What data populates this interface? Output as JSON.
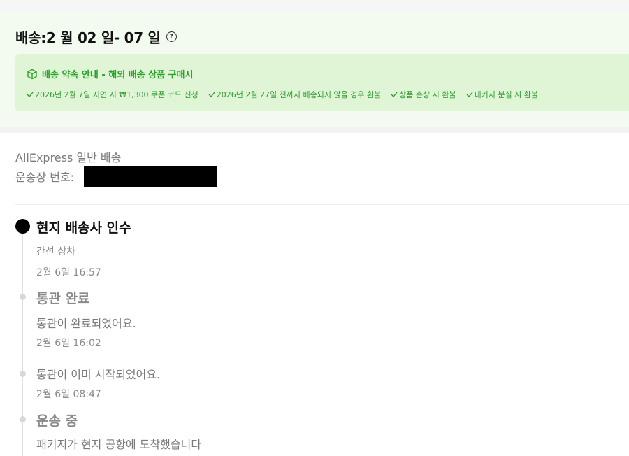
{
  "header": {
    "title": "배송:2 월 02 일- 07 일",
    "help_icon": "question-circle-icon"
  },
  "promise": {
    "icon": "package-box-icon",
    "title": "배송 약속 안내 - 해외 배송 상품 구매시",
    "items": [
      "2026년 2월 7일 지연 시 ₩1,300 쿠폰 코드 신청",
      "2026년 2월 27일 전까지 배송되지 않을 경우 환불",
      "상품 손상 시 환불",
      "패키지 분실 시 환불"
    ]
  },
  "shipment": {
    "carrier": "AliExpress 일반 배송",
    "tracking_label": "운송장 번호:"
  },
  "timeline": {
    "e1": {
      "heading": "현지 배송사 인수",
      "text": "간선 상차",
      "time": "2월 6일 16:57"
    },
    "e2": {
      "heading": "통관 완료",
      "text": "통관이 완료되었어요.",
      "time": "2월 6일 16:02"
    },
    "e3": {
      "text": "통관이 이미 시작되었어요.",
      "time": "2월 6일 08:47"
    },
    "e4": {
      "heading": "운송 중",
      "text": "패키지가 현지 공항에 도착했습니다"
    }
  },
  "colors": {
    "accent_green": "#29a32a",
    "promise_bg": "#dff5d6",
    "header_bg": "#f3fbf0"
  }
}
